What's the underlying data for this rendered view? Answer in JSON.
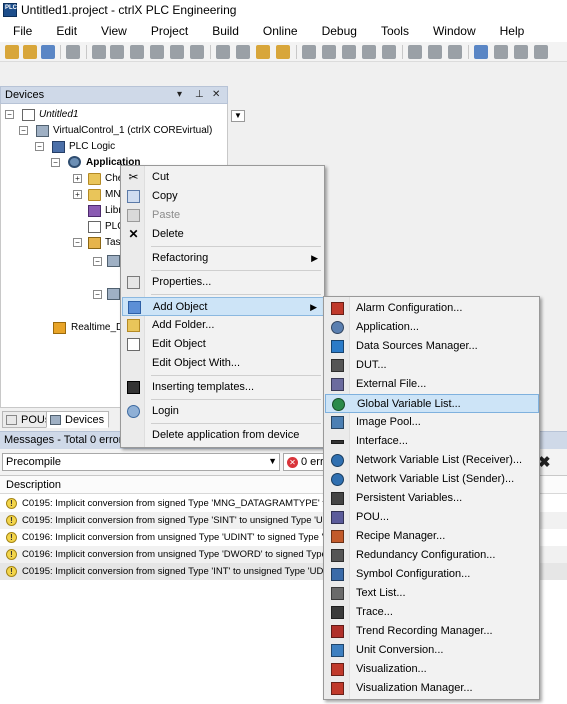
{
  "window": {
    "title": "Untitled1.project - ctrlX PLC Engineering",
    "icon_text": "PLC"
  },
  "menubar": [
    "File",
    "Edit",
    "View",
    "Project",
    "Build",
    "Online",
    "Debug",
    "Tools",
    "Window",
    "Help"
  ],
  "devices_panel": {
    "title": "Devices",
    "header_icons": [
      "dropdown-icon",
      "pin-icon",
      "close-icon"
    ],
    "tree": [
      {
        "label": "Untitled1",
        "icon": "project-icon",
        "italic": true
      },
      {
        "label": "VirtualControl_1 (ctrlX COREvirtual)",
        "icon": "device-icon"
      },
      {
        "label": "PLC Logic",
        "icon": "plc-logic-icon"
      },
      {
        "label": "Application",
        "icon": "application-gear-icon",
        "bold": true
      },
      {
        "label": "Che",
        "icon": "folder-icon"
      },
      {
        "label": "MN",
        "icon": "folder-icon"
      },
      {
        "label": "Libr",
        "icon": "library-icon"
      },
      {
        "label": "PLC",
        "icon": "pou-icon"
      },
      {
        "label": "Tas",
        "icon": "task-config-icon"
      },
      {
        "label": "Realtime_Da",
        "icon": "realtime-icon"
      }
    ]
  },
  "bottom_tabs": [
    {
      "label": "POUs",
      "icon": "pous-icon"
    },
    {
      "label": "Devices",
      "icon": "devices-icon"
    }
  ],
  "messages": {
    "title": "Messages - Total 0 error(s),",
    "filter_value": "Precompile",
    "errors_label": "0 err",
    "column_header": "Description",
    "rows": [
      "C0195: Implicit conversion from signed Type 'MNG_DATAGRAMTYPE' to u",
      "C0195: Implicit conversion from signed Type 'SINT' to unsigned Type 'UL",
      "C0196: Implicit conversion from unsigned Type 'UDINT' to signed Type 'D",
      "C0196: Implicit conversion from unsigned Type 'DWORD' to signed Type",
      "C0195: Implicit conversion from signed Type 'INT' to unsigned Type 'UDI"
    ]
  },
  "context_menu": {
    "items": [
      {
        "label": "Cut",
        "icon": "scissors-icon"
      },
      {
        "label": "Copy",
        "icon": "copy-icon"
      },
      {
        "label": "Paste",
        "icon": "paste-icon",
        "disabled": true
      },
      {
        "label": "Delete",
        "icon": "delete-x-icon"
      },
      {
        "label": "Refactoring",
        "submenu": true
      },
      {
        "label": "Properties...",
        "icon": "properties-icon"
      },
      {
        "label": "Add Object",
        "submenu": true,
        "active": true
      },
      {
        "label": "Add Folder...",
        "icon": "folder-icon"
      },
      {
        "label": "Edit Object",
        "icon": "edit-object-icon"
      },
      {
        "label": "Edit Object With..."
      },
      {
        "label": "Inserting templates...",
        "icon": "template-icon"
      },
      {
        "label": "Login",
        "icon": "login-icon"
      },
      {
        "label": "Delete application from device"
      }
    ]
  },
  "submenu": {
    "items": [
      {
        "label": "Alarm Configuration...",
        "icon": "alarm-config-icon",
        "color": "#c0392b"
      },
      {
        "label": "Application...",
        "icon": "application-gear-icon",
        "color": "#5a7fb0"
      },
      {
        "label": "Data Sources Manager...",
        "icon": "data-sources-icon",
        "color": "#2b7bc8"
      },
      {
        "label": "DUT...",
        "icon": "dut-icon",
        "color": "#555555"
      },
      {
        "label": "External File...",
        "icon": "external-file-icon",
        "color": "#6b6b9e"
      },
      {
        "label": "Global Variable List...",
        "icon": "globe-icon",
        "color": "#2a8a4a",
        "active": true
      },
      {
        "label": "Image Pool...",
        "icon": "image-pool-icon",
        "color": "#4c7fb3"
      },
      {
        "label": "Interface...",
        "icon": "interface-icon",
        "color": "#333333"
      },
      {
        "label": "Network Variable List (Receiver)...",
        "icon": "network-receiver-icon",
        "color": "#2f6fb0"
      },
      {
        "label": "Network Variable List (Sender)...",
        "icon": "network-sender-icon",
        "color": "#2f6fb0"
      },
      {
        "label": "Persistent Variables...",
        "icon": "persistent-vars-icon",
        "color": "#444444"
      },
      {
        "label": "POU...",
        "icon": "pou-icon",
        "color": "#5b5b9a"
      },
      {
        "label": "Recipe Manager...",
        "icon": "recipe-manager-icon",
        "color": "#c25a2a"
      },
      {
        "label": "Redundancy Configuration...",
        "icon": "redundancy-icon",
        "color": "#555555"
      },
      {
        "label": "Symbol Configuration...",
        "icon": "symbol-config-icon",
        "color": "#3a6aa8"
      },
      {
        "label": "Text List...",
        "icon": "text-list-icon",
        "color": "#6a6a6a"
      },
      {
        "label": "Trace...",
        "icon": "trace-icon",
        "color": "#3a3a3a"
      },
      {
        "label": "Trend Recording Manager...",
        "icon": "trend-recording-icon",
        "color": "#b0302a"
      },
      {
        "label": "Unit Conversion...",
        "icon": "unit-conversion-icon",
        "color": "#3d7fc0"
      },
      {
        "label": "Visualization...",
        "icon": "visualization-icon",
        "color": "#c0392b"
      },
      {
        "label": "Visualization Manager...",
        "icon": "visualization-manager-icon",
        "color": "#c0392b"
      }
    ]
  }
}
